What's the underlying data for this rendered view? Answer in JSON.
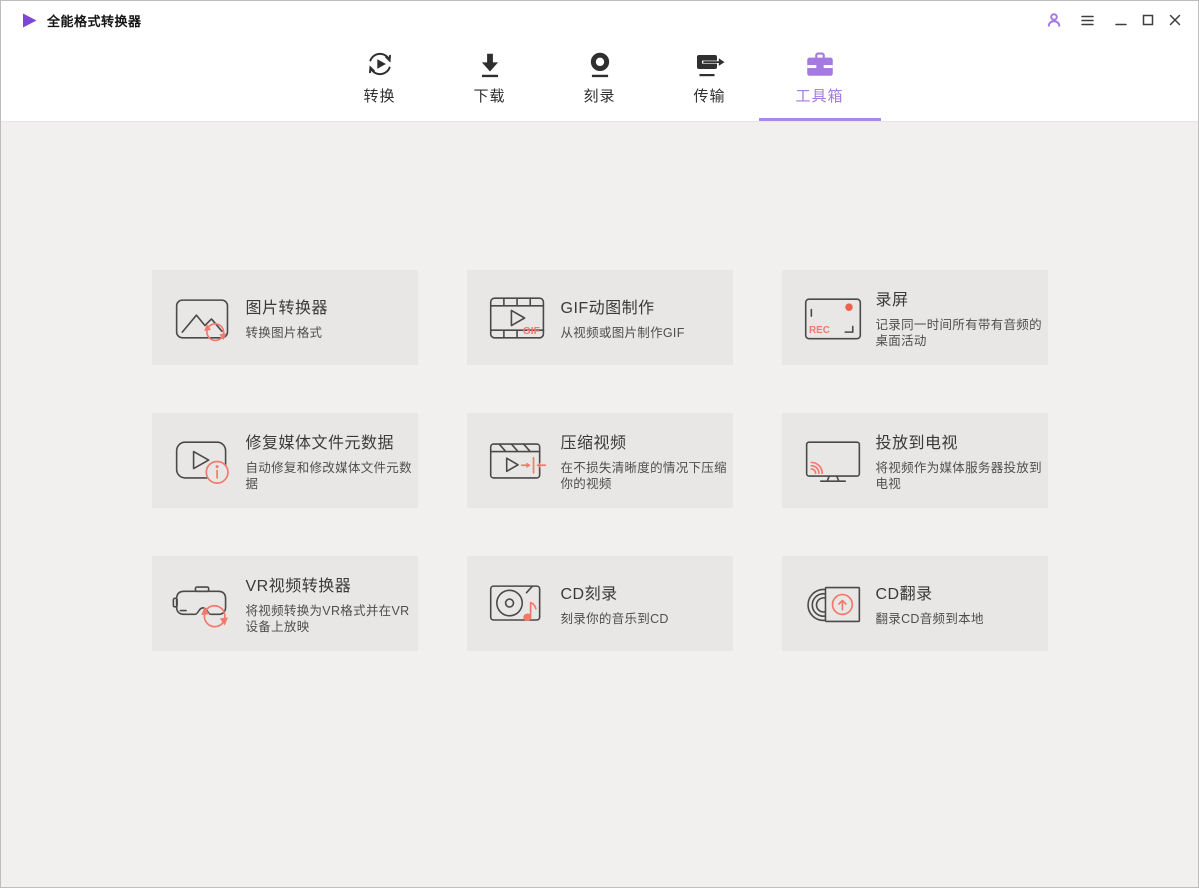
{
  "window": {
    "title": "全能格式转换器",
    "control_icons": [
      "user-icon",
      "menu-icon",
      "minimize-icon",
      "maximize-icon",
      "close-icon"
    ]
  },
  "nav": {
    "tabs": [
      {
        "label": "转换",
        "icon": "convert-icon",
        "active": false
      },
      {
        "label": "下载",
        "icon": "download-icon",
        "active": false
      },
      {
        "label": "刻录",
        "icon": "burn-icon",
        "active": false
      },
      {
        "label": "传输",
        "icon": "transfer-icon",
        "active": false
      },
      {
        "label": "工具箱",
        "icon": "toolbox-icon",
        "active": true
      }
    ]
  },
  "toolbox": {
    "cards": [
      {
        "title": "图片转换器",
        "description": "转换图片格式",
        "icon": "image-converter-icon"
      },
      {
        "title": "GIF动图制作",
        "description": "从视频或图片制作GIF",
        "icon": "gif-maker-icon",
        "icon_label": "GIF"
      },
      {
        "title": "录屏",
        "description": "记录同一时间所有带有音频的桌面活动",
        "icon": "screen-record-icon",
        "icon_label": "REC"
      },
      {
        "title": "修复媒体文件元数据",
        "description": "自动修复和修改媒体文件元数据",
        "icon": "fix-metadata-icon"
      },
      {
        "title": "压缩视频",
        "description": "在不损失清晰度的情况下压缩你的视频",
        "icon": "compress-video-icon"
      },
      {
        "title": "投放到电视",
        "description": "将视频作为媒体服务器投放到电视",
        "icon": "cast-to-tv-icon"
      },
      {
        "title": "VR视频转换器",
        "description": "将视频转换为VR格式并在VR设备上放映",
        "icon": "vr-converter-icon"
      },
      {
        "title": "CD刻录",
        "description": "刻录你的音乐到CD",
        "icon": "cd-burn-icon"
      },
      {
        "title": "CD翻录",
        "description": "翻录CD音频到本地",
        "icon": "cd-rip-icon"
      }
    ]
  },
  "colors": {
    "accent_purple": "#a47ae0",
    "underline_purple": "#a98ae5",
    "accent_salmon": "#f3796c",
    "record_red": "#f0604f",
    "app_icon_purple": "#7e46d4",
    "page_bg": "#f1f0ee",
    "card_bg": "#e9e7e5"
  }
}
